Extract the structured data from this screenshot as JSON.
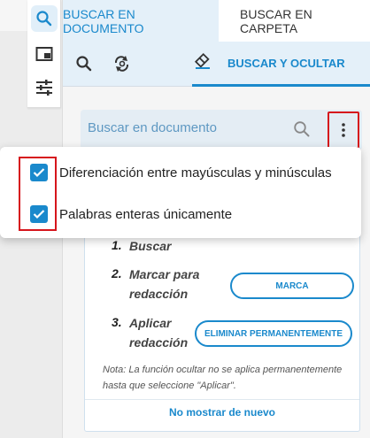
{
  "tabs": {
    "search_document": "BUSCAR EN DOCUMENTO",
    "search_folder": "BUSCAR EN CARPETA"
  },
  "subbar": {
    "search_and_hide": "BUSCAR Y OCULTAR"
  },
  "search": {
    "placeholder": "Buscar en documento"
  },
  "menu": {
    "items": [
      {
        "label": "Diferenciación entre mayúsculas y minúsculas",
        "checked": true
      },
      {
        "label": "Palabras enteras únicamente",
        "checked": true
      }
    ]
  },
  "steps": {
    "step1_num": "1.",
    "step1_label": "Buscar",
    "step2_num": "2.",
    "step2_line1": "Marcar para",
    "step2_line2": "redacción",
    "step2_button": "MARCA",
    "step3_num": "3.",
    "step3_line1": "Aplicar",
    "step3_line2": "redacción",
    "step3_button": "ELIMINAR PERMANENTEMENTE"
  },
  "note": "Nota: La función ocultar no se aplica permanentemente hasta que seleccione \"Aplicar\".",
  "dont_show_again": "No mostrar de nuevo",
  "colors": {
    "accent": "#1a89cc",
    "highlight": "#d6151c"
  }
}
